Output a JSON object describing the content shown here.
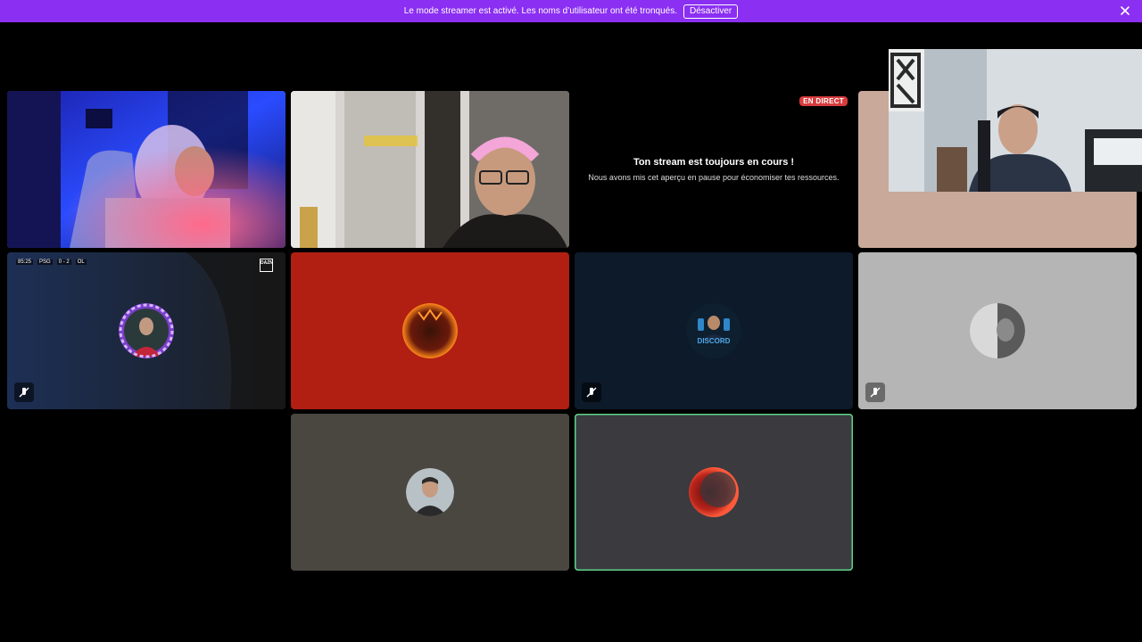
{
  "banner": {
    "message": "Le mode streamer est activé. Les noms d’utilisateur ont été tronqués.",
    "disable_label": "Désactiver",
    "close_icon": "close-icon",
    "color": "#8b2ff2"
  },
  "stream_preview": {
    "live_label": "EN DIRECT",
    "title": "Ton stream est toujours en cours !",
    "subtitle": "Nous avons mis cet aperçu en pause pour économiser tes ressources."
  },
  "tiles": [
    {
      "name": "tile-1",
      "type": "video",
      "speaking": true
    },
    {
      "name": "tile-2",
      "type": "video",
      "speaking": false
    },
    {
      "name": "tile-3",
      "type": "stream-paused",
      "speaking": false
    },
    {
      "name": "tile-4",
      "type": "video-screen",
      "speaking": false
    },
    {
      "name": "tile-5",
      "type": "avatar",
      "muted": true,
      "background": "#1a2a44"
    },
    {
      "name": "tile-6",
      "type": "avatar",
      "muted": false,
      "background": "#b01f12"
    },
    {
      "name": "tile-7",
      "type": "avatar",
      "muted": true,
      "background": "#0c1a2a",
      "avatar_text": "DISCORD"
    },
    {
      "name": "tile-8",
      "type": "avatar",
      "muted": true,
      "background": "#b5b5b5"
    },
    {
      "name": "tile-9",
      "type": "avatar",
      "muted": false,
      "background": "#4a4741"
    },
    {
      "name": "tile-10",
      "type": "avatar",
      "muted": false,
      "speaking": true,
      "background": "#3a3a3f"
    }
  ],
  "tile5_overlay": {
    "score_time": "85:25",
    "team_home": "PSG",
    "score": "0 - 2",
    "team_away": "OL",
    "broadcaster": "DAZN"
  },
  "accent": {
    "speaking_ring": "#5fd38a",
    "live_red": "#d83c3e"
  }
}
